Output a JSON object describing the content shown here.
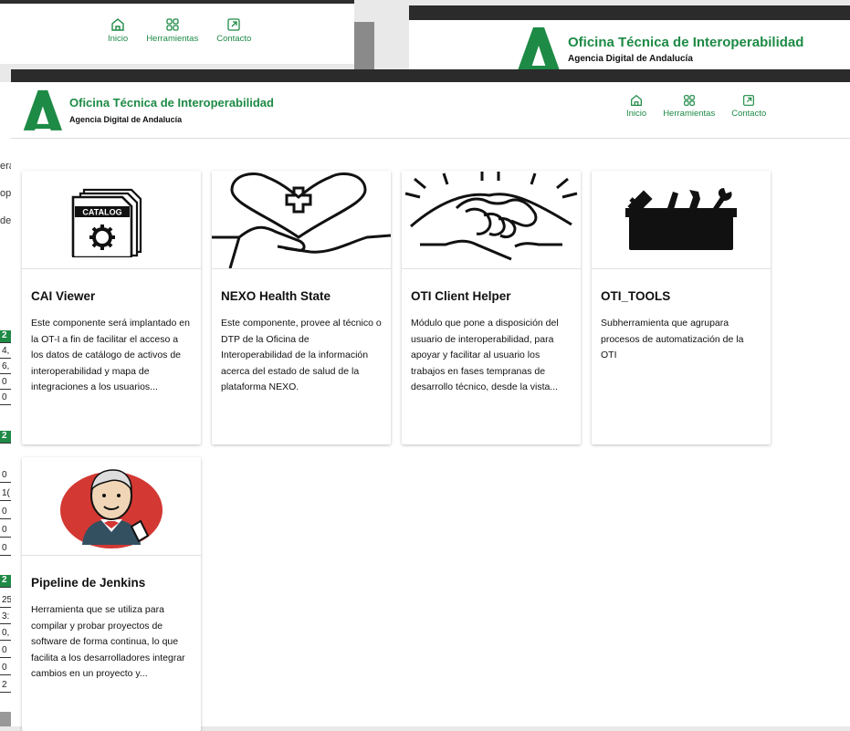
{
  "nav": {
    "items": [
      {
        "label": "Inicio"
      },
      {
        "label": "Herramientas"
      },
      {
        "label": "Contacto"
      }
    ]
  },
  "brand": {
    "title": "Oficina Técnica de Interoperabilidad",
    "subtitle": "Agencia Digital de Andalucía",
    "color": "#1d8a45"
  },
  "background_fragments": {
    "left_texts": [
      "era",
      "ope",
      "der"
    ],
    "cells": [
      "2",
      "4,",
      "6,",
      "0",
      "0",
      "2",
      "0",
      "1(",
      "0",
      "0",
      "0",
      "2",
      "25",
      "3:",
      "0,",
      "0",
      "0",
      "2"
    ]
  },
  "tools": [
    {
      "title": "CAI Viewer",
      "description": "Este componente será implantado en la OT-I a fin de facilitar el acceso a los datos de catálogo de activos de interoperabilidad y mapa de integraciones a los usuarios...",
      "icon": "catalog-icon",
      "icon_text": "CATALOG"
    },
    {
      "title": "NEXO Health State",
      "description": "Este componente, provee al técnico o DTP de la Oficina de Interoperabilidad de la información acerca del estado de salud de la plataforma NEXO.",
      "icon": "heart-hand-icon"
    },
    {
      "title": "OTI Client Helper",
      "description": "Módulo que pone a disposición del usuario de interoperabilidad, para apoyar y facilitar al usuario los trabajos en fases tempranas de desarrollo técnico, desde la vista...",
      "icon": "handshake-icon"
    },
    {
      "title": "OTI_TOOLS",
      "description": "Subherramienta que agrupara procesos de automatización de la OTI",
      "icon": "toolbox-icon"
    },
    {
      "title": "Pipeline de Jenkins",
      "description": "Herramienta que se utiliza para compilar y probar proyectos de software de forma continua, lo que facilita a los desarrolladores integrar cambios en un proyecto y...",
      "icon": "jenkins-icon"
    }
  ]
}
